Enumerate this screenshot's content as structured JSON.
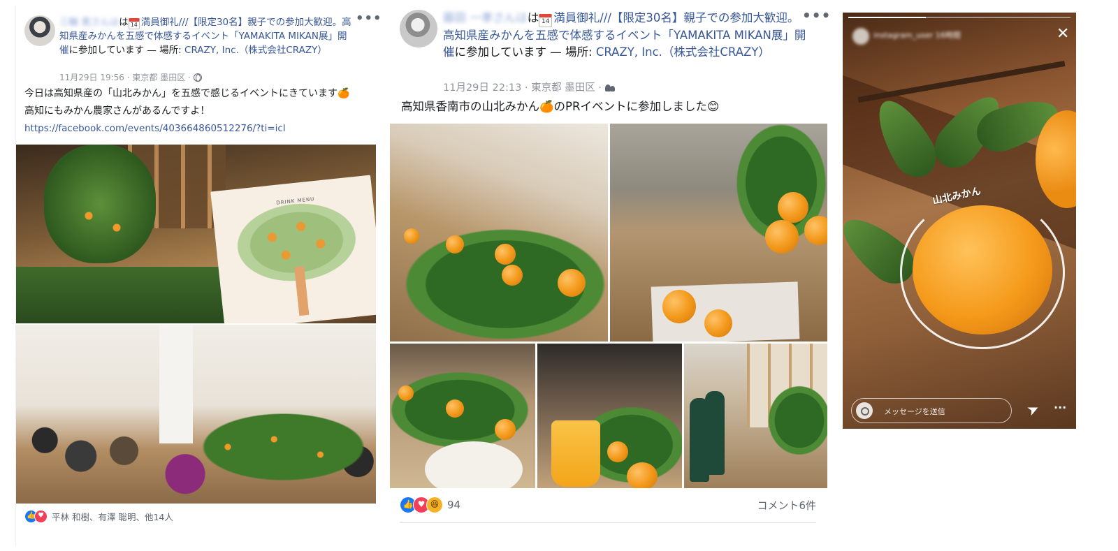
{
  "post1": {
    "author": "三輪 寛",
    "author_suffix": "さんは",
    "calendar_day": "14",
    "event_title": "満員御礼///【限定30名】親子での参加大歓迎。高知県産みかんを五感で体感するイベント「YAMAKITA MIKAN展」開催",
    "participating": "に参加しています — 場所: ",
    "place": "CRAZY, Inc.（株式会社CRAZY）",
    "timestamp": "11月29日 19:56",
    "location": "東京都 墨田区",
    "audience_icon": "globe-icon",
    "body_line1": "今日は高知県産の「山北みかん」を五感で感じるイベントにきています🍊",
    "body_line2": "高知にもみかん農家さんがあるんですよ！",
    "link": "https://facebook.com/events/403664860512276/?ti=icl",
    "menu_text": "DRINK MENU",
    "reactions_text": "平林 和樹、有澤 聡明、他14人",
    "reaction_icons": [
      "like-icon",
      "love-icon"
    ]
  },
  "post2": {
    "author": "藤田 一孝",
    "author_suffix": "さんは",
    "calendar_day": "14",
    "event_title": "満員御礼///【限定30名】親子での参加大歓迎。高知県産みかんを五感で体感するイベント「YAMAKITA MIKAN展」開催",
    "participating": "に参加しています — 場所: ",
    "place": "CRAZY, Inc.（株式会社CRAZY）",
    "timestamp": "11月29日 22:13",
    "location": "東京都 墨田区",
    "audience_icon": "friends-icon",
    "body": "高知県香南市の山北みかん🍊のPRイベントに参加しました😊",
    "reaction_count": "94",
    "comments": "コメント6件",
    "reaction_icons": [
      "like-icon",
      "love-icon",
      "haha-icon"
    ]
  },
  "story": {
    "username": "instagram_user",
    "time": "16時間",
    "sticker": "山北みかん",
    "message_placeholder": "メッセージを送信",
    "progress": 0.35,
    "icons": [
      "close-icon",
      "camera-icon",
      "send-icon",
      "more-icon"
    ]
  }
}
